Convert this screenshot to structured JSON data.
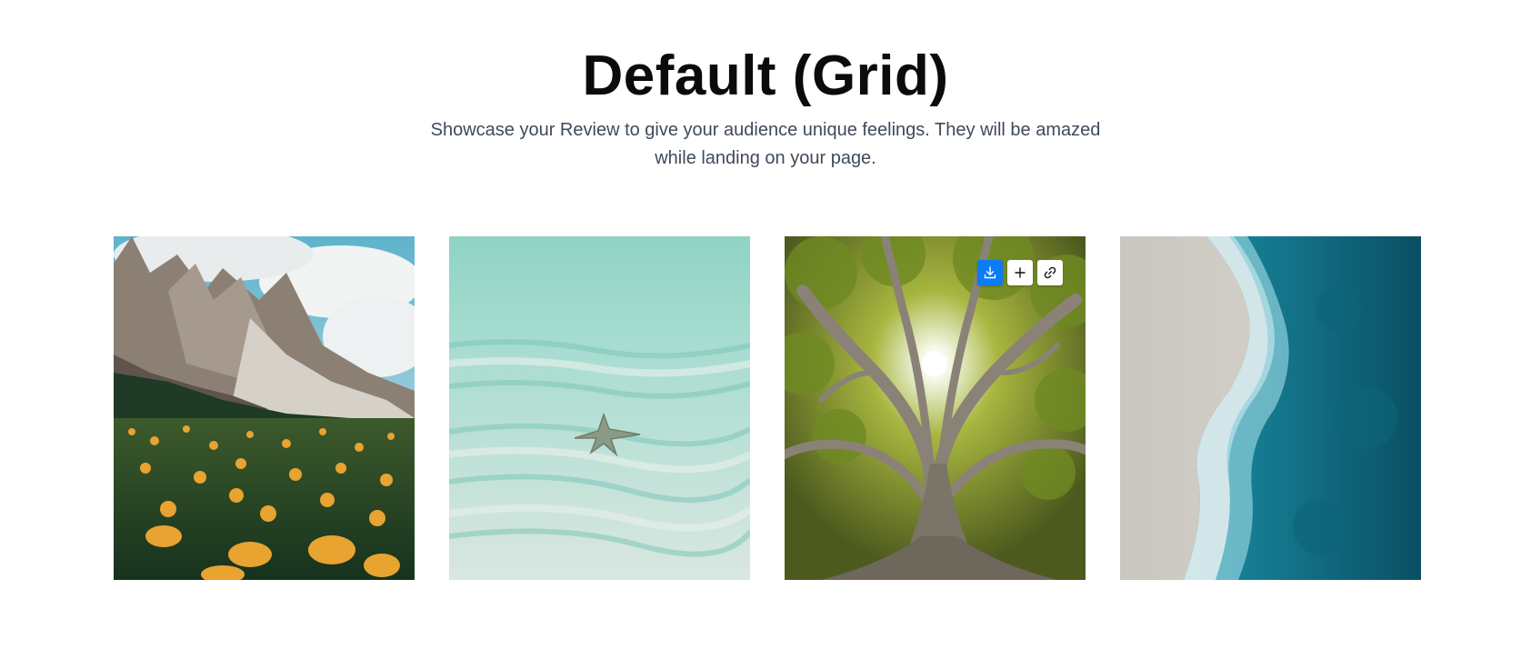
{
  "header": {
    "title": "Default (Grid)",
    "subtitle": "Showcase your Review to give your audience unique feelings. They will be amazed while landing on your page."
  },
  "gallery": {
    "items": [
      {
        "subject": "mountain-meadow",
        "icon": "mountain-flower-photo"
      },
      {
        "subject": "underwater-starfish",
        "icon": "starfish-photo"
      },
      {
        "subject": "tree-canopy",
        "icon": "tree-photo",
        "hovered": true
      },
      {
        "subject": "ocean-shore",
        "icon": "ocean-wave-photo"
      }
    ],
    "actions": [
      {
        "name": "download",
        "icon": "download-icon"
      },
      {
        "name": "add",
        "icon": "plus-icon"
      },
      {
        "name": "link",
        "icon": "link-icon"
      }
    ]
  },
  "colors": {
    "accent": "#0b7cf5",
    "title": "#0b0b0b",
    "subtitle": "#3f4a5a",
    "background": "#ffffff"
  }
}
